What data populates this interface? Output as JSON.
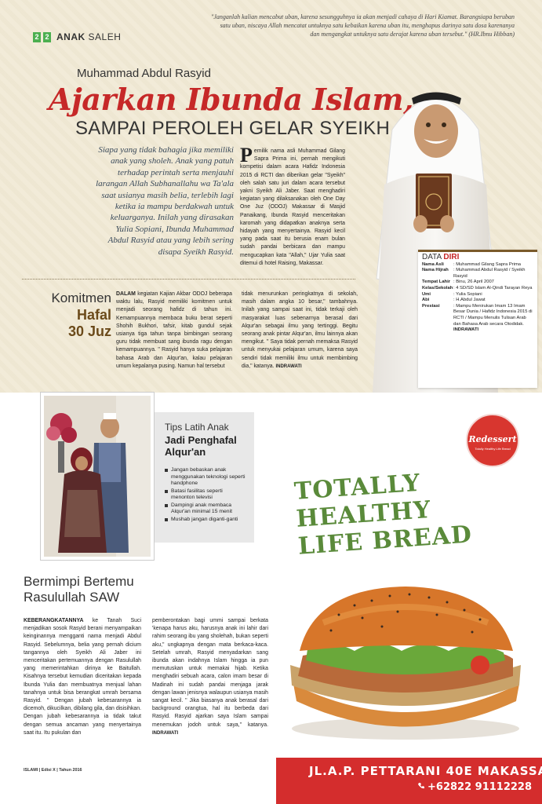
{
  "header": {
    "page_numbers": [
      "2",
      "2"
    ],
    "section_bold": "ANAK",
    "section_light": " SALEH",
    "quote": "\"Janganlah kalian mencabut uban, karena sesungguhnya ia akan menjadi cahaya di Hari Kiamat. Barangsiapa beruban satu uban, niscaya Allah mencatat untuknya satu kebaikan karena uban itu, menghapus darinya satu dosa karenanya dan mengangkat untuknya satu derajat karena uban tersebut.\" (HR.Ibnu Hibban)"
  },
  "article": {
    "author": "Muhammad Abdul Rasyid",
    "headline": "Ajarkan Ibunda Islam,",
    "subhead": "SAMPAI PEROLEH GELAR SYEIKH",
    "lead": "Siapa yang tidak bahagia jika memiliki anak yang sholeh. Anak yang patuh terhadap perintah serta menjauhi larangan Allah Subhanallahu wa Ta'ala saat usianya masih belia, terlebih lagi ketika ia mampu berdakwah untuk keluarganya. Inilah yang dirasakan Yulia Sopiani, Ibunda Muhammad Abdul Rasyid atau yang lebih sering disapa Syeikh Rasyid.",
    "dropcap": "P",
    "col1": "emilik nama asli Muhammad Gilang Sapra Prima ini, pernah mengikuti kompetisi dalam acara Hafidz Indonesia 2015 di RCTI dan diberikan gelar \"Syeikh\" oleh salah satu juri dalam acara tersebut yakni Syeikh Ali Jaber. Saat menghadiri kegiatan yang dilaksanakan oleh One Day One Juz (ODOJ) Makassar di Masjid Panaikang, Ibunda Rasyid menceritakan karomah yang didapatkan anaknya serta hidayah yang menyertainya. Rasyid kecil yang pada saat itu berusia enam bulan sudah pandai berbicara dan mampu mengucapkan kata \"Allah,\" Ujar Yulia saat ditemui di hotel Raising, Makassar.",
    "komitmen": [
      "Komitmen",
      "Hafal",
      "30 Juz"
    ],
    "col2_bold": "DALAM",
    "col2": " kegiatan Kajian Akbar ODOJ beberapa waktu lalu, Rasyid memiliki komitmen untuk menjadi seorang hafidz di tahun ini. Kemampuannya membaca buku berat seperti Shohih Bukhori, tafsir, kitab gundul sejak usianya tiga tahun tanpa bimbingan seorang guru tidak membuat sang ibunda ragu dengan kemampuannya. \" Rasyid hanya suka pelajaran bahasa Arab dan Alqur'an, kalau pelajaran umum kepalanya pusing. Namun hal tersebut",
    "col3": "tidak menurunkan peringkatnya di sekolah, masih dalam angka 10 besar,\" tambahnya. Inilah yang sampai saat ini, tidak terkaji oleh masyarakat luas sebenarnya berasal dari Alqur'an sebagai ilmu yang tertinggi. Begitu seorang anak pintar Alqur'an, ilmu lainnya akan mengikut. \" Saya tidak pernah memaksa Rasyid untuk menyukai pelajaran umum, karena saya sendiri tidak memiliki ilmu untuk membimbing dia,\" katanya.",
    "signature": "INDRAWATI"
  },
  "data_diri": {
    "title_light": "DATA ",
    "title_bold": "DIRI",
    "rows": [
      {
        "k": "Nama Asli",
        "v": ": Muhammad Gilang Sapra Prima"
      },
      {
        "k": "Nama Hijrah",
        "v": ": Muhammad Abdul Rasyid / Syeikh Rasyid"
      },
      {
        "k": "Tempat Lahir",
        "v": ": Binu, 26 April 2007"
      },
      {
        "k": "Kelas/Sekolah",
        "v": ": 4 SD/SD Islam Al-Qindi Tarayan Reya"
      },
      {
        "k": "Umi",
        "v": ": Yulia Sopiani"
      },
      {
        "k": "Abi",
        "v": ": H.Abdul Jawat"
      },
      {
        "k": "Prestasi",
        "v": ": Mampu Menirukan Imam 13 Imam Besar Dunia / Hafidz Indonesia 2015 di RCTI / Mampu Menulis Tulisan Arab dan Bahasa Arab secara Otodidak."
      }
    ],
    "signature": "INDRAWATI"
  },
  "tips": {
    "pre": "Tips Latih Anak",
    "title": "Jadi Penghafal Alqur'an",
    "items": [
      "Jangan bebaskan anak menggunakan teknologi seperti handphone",
      "Batasi fasilitas seperti menonton televisi",
      "Dampingi anak membaca Alqur'an minimal 15 menit",
      "Mushab jangan diganti-ganti"
    ]
  },
  "story": {
    "title": "Bermimpi Bertemu Rasulullah SAW",
    "col4_bold": "KEBERANGKATANNYA",
    "col4": " ke Tanah Suci menjadikan sosok Rasyid berani menyampaikan keinginannya mengganti nama menjadi Abdul Rasyid. Sebelumnya, belia yang pernah dicium tangannya oleh Syeikh Ali Jaber ini menceritakan pertemuannya dengan Rasulullah yang memerintahkan dirinya ke Baitullah. Kisahnya tersebut kemudian diceritakan kepada Ibunda Yulia dan membuatnya menjual lahan tanahnya untuk bisa berangkat umrah bersama Rasyid. \" Dengan jubah kebesarannya ia dicemoh, dikucilkan, dibilang gila, dan disisihkan. Dengan jubah kebesarannya ia tidak takut dengan semua ancaman yang menyertainya saat itu. Itu pukulan dan",
    "col5": "pemberontakan bagi ummi sampai berkata 'kenapa harus aku, harusnya anak ini lahir dari rahim seorang ibu yang sholehah, bukan seperti aku,\" ungkapnya dengan mata berkaca-kaca. Setelah umrah, Rasyid menyadarkan sang ibunda akan indahnya Islam hingga ia pun memutuskan untuk memakai hijab. Ketika menghadiri sebuah acara, calon imam besar di Madinah ini sudah pandai menjaga jarak dengan lawan jenisnya walaupun usianya masih sangat kecil. \" Jika biasanya anak berasal dari background orangtua, hal itu berbeda dari Rasyid. Rasyid ajarkan saya Islam sampai menemukan jodoh untuk saya,\" katanya.",
    "signature": "INDRAWATI"
  },
  "footer": "ISLAMI | Edisi X | Tahun 2016",
  "ad": {
    "logo": "Redessert",
    "logo_sub": "Totally Healthy Life Bread",
    "headline": [
      "TOTALLY",
      "HEALTHY",
      "LIFE BREAD"
    ],
    "address": "JL.A.P. PETTARANI 40E MAKASSAR",
    "phone": "+62822 91112228",
    "colors": {
      "accent": "#d42d2d",
      "green": "#5a8a3a"
    }
  }
}
